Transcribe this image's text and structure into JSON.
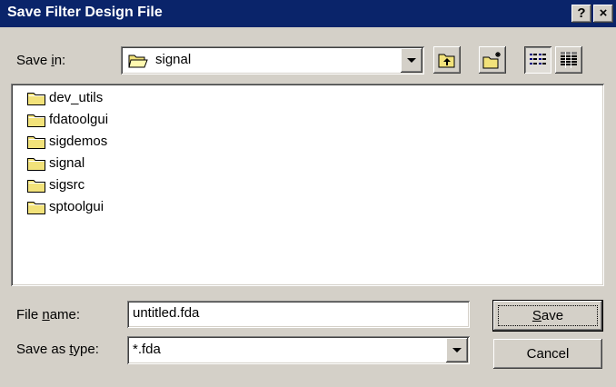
{
  "dialog": {
    "title": "Save Filter Design File",
    "help_button": "?",
    "close_button": "×"
  },
  "save_in": {
    "label_pre": "Save ",
    "label_key": "i",
    "label_post": "n:",
    "value": "signal"
  },
  "toolbar": {
    "icons": [
      "up-one-level-icon",
      "create-new-folder-icon",
      "list-view-icon",
      "details-view-icon"
    ],
    "list_view_pressed": true
  },
  "files": [
    {
      "name": "dev_utils",
      "icon": "folder-icon"
    },
    {
      "name": "fdatoolgui",
      "icon": "folder-icon"
    },
    {
      "name": "sigdemos",
      "icon": "folder-icon"
    },
    {
      "name": "signal",
      "icon": "folder-icon"
    },
    {
      "name": "sigsrc",
      "icon": "folder-icon"
    },
    {
      "name": "sptoolgui",
      "icon": "folder-icon"
    }
  ],
  "file_name": {
    "label_pre": "File ",
    "label_key": "n",
    "label_post": "ame:",
    "value": "untitled.fda"
  },
  "save_as_type": {
    "label_pre": "Save as ",
    "label_key": "t",
    "label_post": "ype:",
    "value": "*.fda"
  },
  "buttons": {
    "save_key": "S",
    "save_rest": "ave",
    "cancel": "Cancel"
  },
  "colors": {
    "titlebar": "#0a246a",
    "face": "#d4d0c8",
    "folder": "#f2e27a"
  }
}
